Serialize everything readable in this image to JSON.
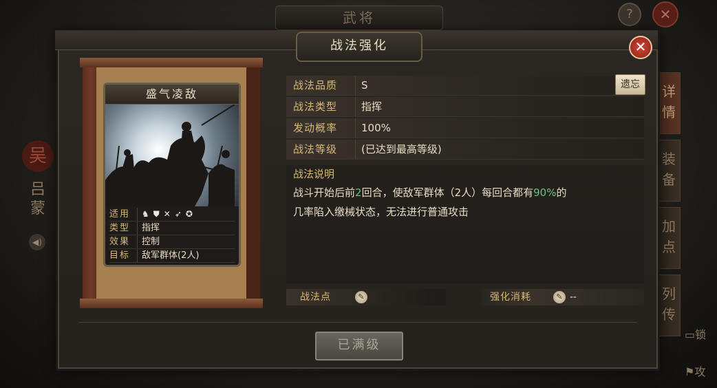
{
  "background": {
    "title": "武将",
    "help_label": "?",
    "close_label": "✕",
    "faction": "吴",
    "general_name": "吕蒙",
    "tabs": [
      "详情",
      "装备",
      "加点",
      "列传"
    ],
    "lock_label": "锁",
    "attack_label": "攻"
  },
  "dialog": {
    "title": "战法强化",
    "close_label": "✕",
    "legacy_button": "遗忘"
  },
  "card": {
    "name": "盛气凌敌",
    "rows": {
      "suitable_label": "适用",
      "type_label": "类型",
      "type_value": "指挥",
      "effect_label": "效果",
      "effect_value": "控制",
      "target_label": "目标",
      "target_value": "敌军群体(2人)"
    },
    "unit_icons": [
      "cavalry-icon",
      "shield-icon",
      "bow-icon",
      "spear-icon",
      "siege-icon"
    ]
  },
  "props": [
    {
      "label": "战法品质",
      "value": "S"
    },
    {
      "label": "战法类型",
      "value": "指挥"
    },
    {
      "label": "发动概率",
      "value": "100%"
    },
    {
      "label": "战法等级",
      "value": "(已达到最高等级)"
    }
  ],
  "description": {
    "title": "战法说明",
    "part1": "战斗开始后前",
    "rounds": "2",
    "part2": "回合，使敌军群体（2人）每回合都有",
    "rate": "90%",
    "part3": "的",
    "line2": "几率陷入缴械状态，无法进行普通攻击"
  },
  "bottom": {
    "points_label": "战法点",
    "cost_label": "强化消耗",
    "cost_value": "--"
  },
  "max_button": "已满级",
  "colors": {
    "gold_label": "#d8b878",
    "highlight_green": "#6ac08a",
    "close_red": "#c83a2c"
  }
}
